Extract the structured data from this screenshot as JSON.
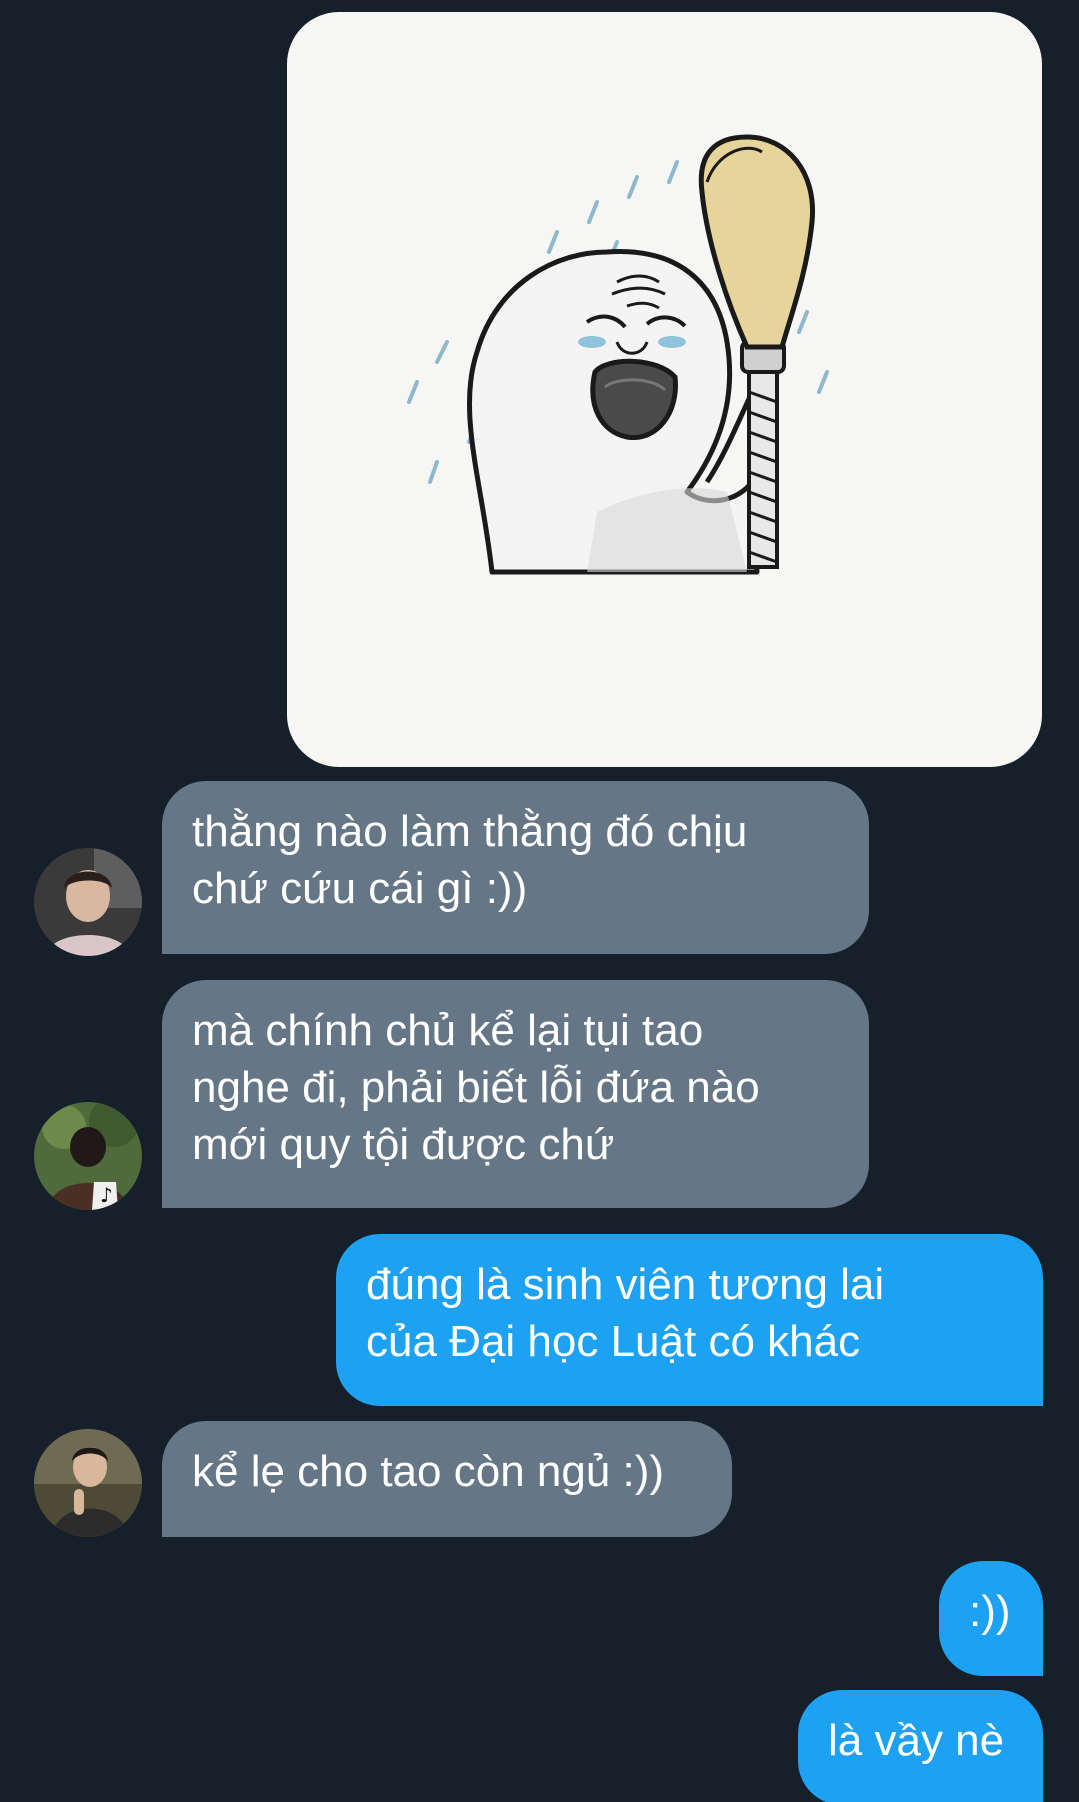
{
  "conversation": {
    "media": {
      "type": "image",
      "description_icon": "crying-shower-meme-image"
    },
    "messages": [
      {
        "direction": "incoming",
        "text": "thằng nào làm thằng đó chịu\nchứ cứu cái gì :))"
      },
      {
        "direction": "incoming",
        "text": "mà chính chủ kể lại tụi tao\nnghe đi, phải biết lỗi đứa nào\nmới quy tội được chứ"
      },
      {
        "direction": "outgoing",
        "text": "đúng là sinh viên tương lai\ncủa Đại học Luật có khác"
      },
      {
        "direction": "incoming",
        "text": "kể lẹ cho tao còn ngủ :))"
      },
      {
        "direction": "outgoing",
        "text": ":))"
      },
      {
        "direction": "outgoing",
        "text": "là vầy nè"
      }
    ]
  },
  "colors": {
    "background": "#15202b",
    "incoming_bubble": "#657786",
    "outgoing_bubble": "#1da1f2",
    "text": "#ffffff"
  }
}
